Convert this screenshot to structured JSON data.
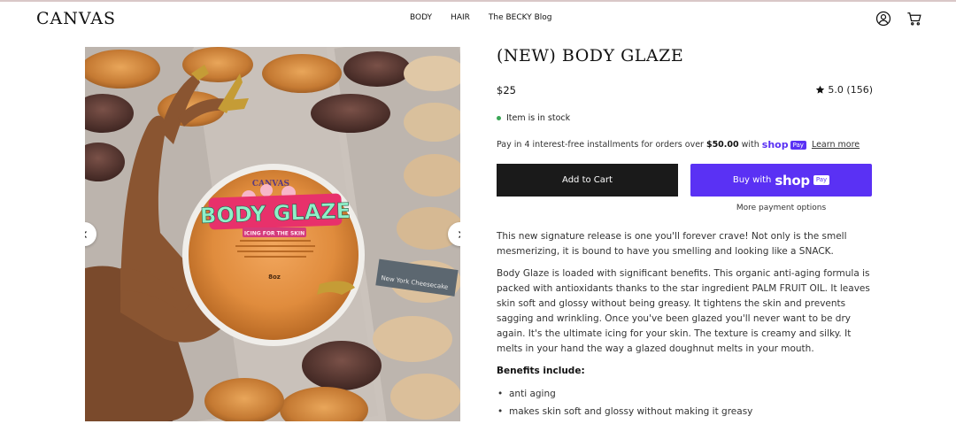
{
  "header": {
    "logo": "CANVAS",
    "nav": [
      {
        "label": "BODY"
      },
      {
        "label": "HAIR"
      },
      {
        "label": "The BECKY Blog"
      }
    ],
    "icons": [
      "user-icon",
      "cart-icon"
    ]
  },
  "gallery": {
    "label_title": "BODY GLAZE",
    "label_subtitle": "ICING FOR THE SKIN",
    "label_brand": "CANVAS",
    "label_size": "8oz",
    "sign_text": "New York Cheesecake",
    "prev_icon": "chevron-left-icon",
    "next_icon": "chevron-right-icon"
  },
  "product": {
    "title": "(NEW) BODY GLAZE",
    "price": "$25",
    "rating": "5.0 (156)",
    "rating_icon": "star-icon",
    "stock": "Item is in stock",
    "installments": {
      "prefix": "Pay in 4 interest-free installments for orders over",
      "amount": "$50.00",
      "with": "with",
      "shop": "shop",
      "pay": "Pay",
      "learn_more": "Learn more"
    },
    "add_to_cart": "Add to Cart",
    "buy_with": "Buy with",
    "buy_shop": "shop",
    "buy_pay": "Pay",
    "more_payment": "More payment options",
    "description": [
      "This new signature release is one you'll forever crave! Not only is the smell mesmerizing, it is bound to have you smelling and looking like a SNACK.",
      "Body Glaze is loaded with significant benefits. This organic anti-aging formula is packed with antioxidants thanks to the star ingredient PALM FRUIT OIL. It leaves skin soft and glossy without being greasy. It tightens the skin and prevents sagging and wrinkling. Once you've been glazed you'll never want to be dry again. It's the ultimate icing for your skin. The texture is creamy and silky. It melts in your hand the way a glazed doughnut melts in your mouth."
    ],
    "benefits_heading": "Benefits include:",
    "benefits": [
      "anti aging",
      "makes skin soft and glossy without making it greasy"
    ]
  },
  "colors": {
    "accent_shop": "#5a31f4",
    "cart_button": "#1a1a1a",
    "stock_dot": "#3aa655"
  }
}
